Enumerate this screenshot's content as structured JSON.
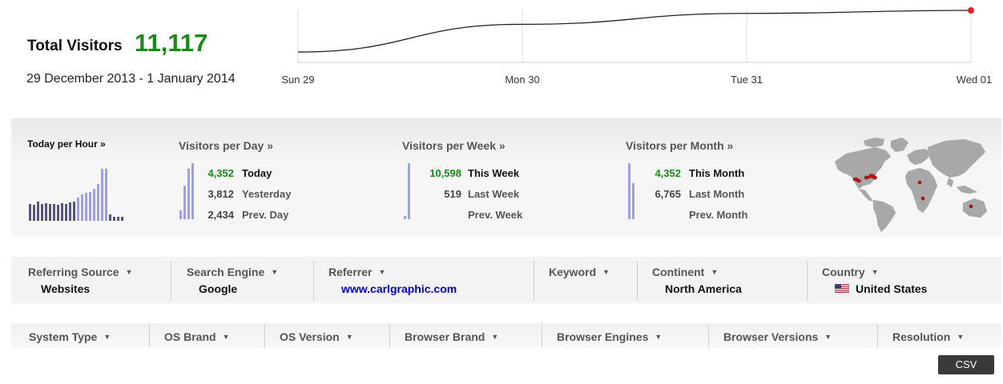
{
  "header": {
    "total_label": "Total Visitors",
    "total_value": "11,117",
    "date_range": "29 December 2013 - 1 January 2014"
  },
  "chart_data": {
    "type": "line",
    "x": [
      "Sun 29",
      "Mon 30",
      "Tue 31",
      "Wed 01"
    ],
    "series": [
      {
        "values": [
          2434,
          3812,
          4352,
          4500
        ]
      }
    ],
    "grid": true,
    "colors": {
      "line": "#222222",
      "last_point": "#e61e1e",
      "grid": "#dddddd"
    }
  },
  "stats": {
    "hour": {
      "title": "Today per Hour »",
      "bars": [
        0.28,
        0.26,
        0.31,
        0.28,
        0.29,
        0.28,
        0.27,
        0.26,
        0.29,
        0.28,
        0.3,
        0.32,
        0.38,
        0.44,
        0.46,
        0.48,
        0.52,
        0.6,
        0.86,
        0.86,
        0.1,
        0.07,
        0.06,
        0.06
      ]
    },
    "day": {
      "title": "Visitors per Day »",
      "rows": [
        {
          "value": "4,352",
          "label": "Today"
        },
        {
          "value": "3,812",
          "label": "Yesterday"
        },
        {
          "value": "2,434",
          "label": "Prev. Day"
        }
      ],
      "bars": [
        0.15,
        0.6,
        0.9,
        1.0
      ]
    },
    "week": {
      "title": "Visitors per Week »",
      "rows": [
        {
          "value": "10,598",
          "label": "This Week"
        },
        {
          "value": "519",
          "label": "Last Week"
        },
        {
          "value": "",
          "label": "Prev. Week"
        }
      ],
      "bars": [
        0.05,
        1.0
      ]
    },
    "month": {
      "title": "Visitors per Month »",
      "rows": [
        {
          "value": "4,352",
          "label": "This Month"
        },
        {
          "value": "6,765",
          "label": "Last Month"
        },
        {
          "value": "",
          "label": "Prev. Month"
        }
      ],
      "bars": [
        1.0,
        0.64
      ]
    }
  },
  "filters_row1": [
    {
      "label": "Referring Source",
      "value": "Websites"
    },
    {
      "label": "Search Engine",
      "value": "Google"
    },
    {
      "label": "Referrer",
      "value": "www.carlgraphic.com"
    },
    {
      "label": "Keyword",
      "value": ""
    },
    {
      "label": "Continent",
      "value": "North America"
    },
    {
      "label": "Country",
      "value": "United States"
    }
  ],
  "filters_row2": [
    {
      "label": "System Type"
    },
    {
      "label": "OS Brand"
    },
    {
      "label": "OS Version"
    },
    {
      "label": "Browser Brand"
    },
    {
      "label": "Browser Engines"
    },
    {
      "label": "Browser Versions"
    },
    {
      "label": "Resolution"
    }
  ],
  "export": {
    "csv_label": "CSV"
  },
  "colors": {
    "accent_green": "#1a8a1a",
    "bar_light": "#9f9fe8",
    "bar_dark": "#555577",
    "link": "#0000cc"
  }
}
